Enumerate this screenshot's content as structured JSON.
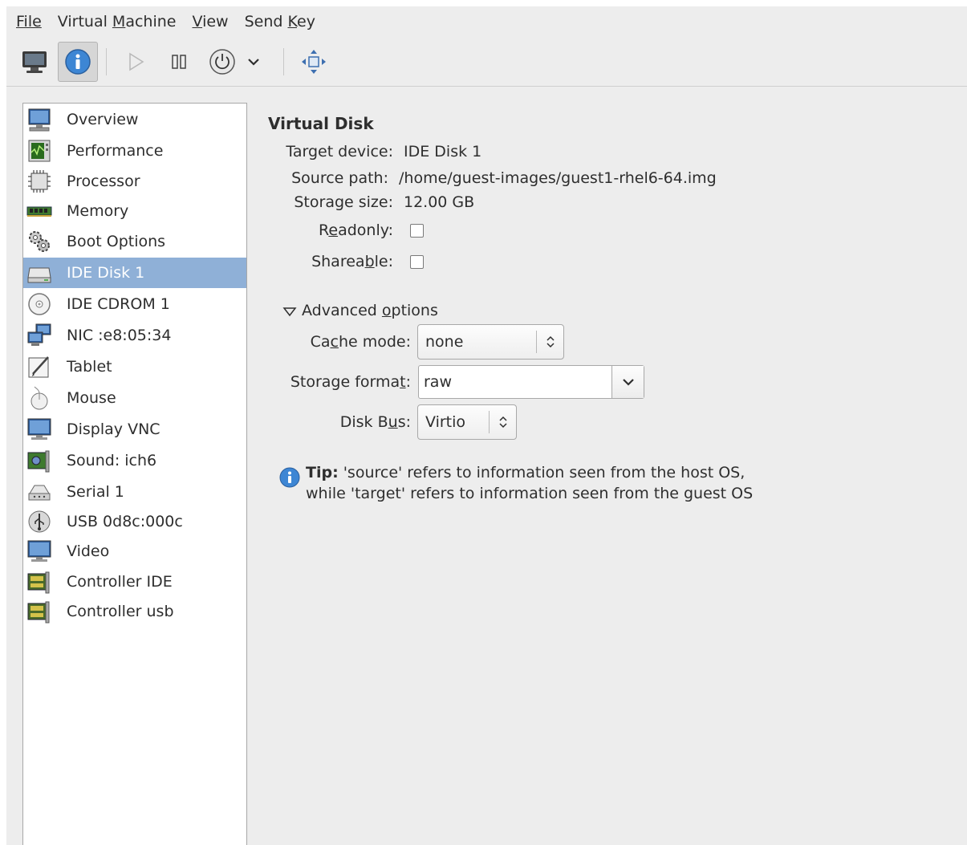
{
  "menubar": {
    "items": [
      {
        "label": "File"
      },
      {
        "label": "Virtual Machine"
      },
      {
        "label": "View"
      },
      {
        "label": "Send Key"
      }
    ]
  },
  "toolbar": {
    "buttons": [
      {
        "icon": "console-icon"
      },
      {
        "icon": "info-icon",
        "active": true
      },
      {
        "icon": "play-icon"
      },
      {
        "icon": "pause-icon"
      },
      {
        "icon": "power-icon"
      },
      {
        "icon": "chevron-down-icon"
      },
      {
        "icon": "fullscreen-move-icon"
      }
    ]
  },
  "sidebar": {
    "items": [
      {
        "label": "Overview",
        "icon": "monitor-icon"
      },
      {
        "label": "Performance",
        "icon": "performance-graph-icon"
      },
      {
        "label": "Processor",
        "icon": "cpu-chip-icon"
      },
      {
        "label": "Memory",
        "icon": "ram-stick-icon"
      },
      {
        "label": "Boot Options",
        "icon": "gears-icon"
      },
      {
        "label": "IDE Disk 1",
        "icon": "hard-disk-icon",
        "selected": true
      },
      {
        "label": "IDE CDROM 1",
        "icon": "cdrom-icon"
      },
      {
        "label": "NIC :e8:05:34",
        "icon": "network-icon"
      },
      {
        "label": "Tablet",
        "icon": "tablet-pen-icon"
      },
      {
        "label": "Mouse",
        "icon": "mouse-icon"
      },
      {
        "label": "Display VNC",
        "icon": "display-icon"
      },
      {
        "label": "Sound: ich6",
        "icon": "sound-card-icon"
      },
      {
        "label": "Serial 1",
        "icon": "serial-port-icon"
      },
      {
        "label": "USB 0d8c:000c",
        "icon": "usb-icon"
      },
      {
        "label": "Video",
        "icon": "video-monitor-icon"
      },
      {
        "label": "Controller IDE",
        "icon": "controller-card-icon"
      },
      {
        "label": "Controller usb",
        "icon": "controller-card-icon"
      }
    ]
  },
  "main": {
    "title": "Virtual Disk",
    "target_device_label": "Target device:",
    "target_device_value": "IDE Disk 1",
    "source_path_label": "Source path:",
    "source_path_value": "/home/guest-images/guest1-rhel6-64.img",
    "storage_size_label": "Storage size:",
    "storage_size_value": "12.00 GB",
    "readonly_label": "Readonly:",
    "readonly_checked": false,
    "shareable_label": "Shareable:",
    "shareable_checked": false,
    "advanced_label": "Advanced options",
    "cache_mode_label": "Cache mode:",
    "cache_mode_value": "none",
    "storage_format_label": "Storage format:",
    "storage_format_value": "raw",
    "disk_bus_label": "Disk Bus:",
    "disk_bus_value": "Virtio",
    "tip_bold": "Tip:",
    "tip_line1": " 'source' refers to information seen from the host OS,",
    "tip_line2": "while 'target' refers to information seen from the guest OS"
  }
}
